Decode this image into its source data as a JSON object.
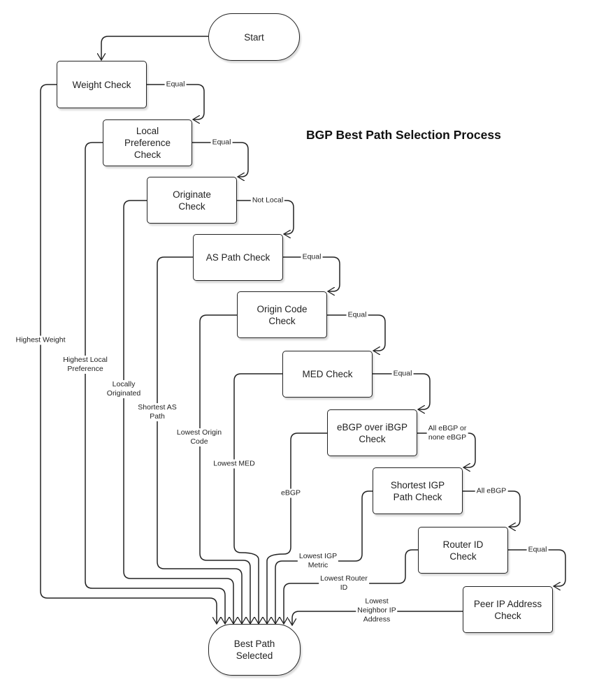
{
  "title": "BGP Best Path Selection Process",
  "nodes": {
    "start": "Start",
    "weight": "Weight Check",
    "local_pref": "Local\nPreference\nCheck",
    "originate": "Originate\nCheck",
    "as_path": "AS Path Check",
    "origin_code": "Origin Code\nCheck",
    "med": "MED Check",
    "ebgp": "eBGP over iBGP\nCheck",
    "igp": "Shortest IGP\nPath Check",
    "router_id": "Router ID\nCheck",
    "peer_ip": "Peer IP Address\nCheck",
    "end": "Best Path\nSelected"
  },
  "next_labels": {
    "weight": "Equal",
    "local_pref": "Equal",
    "originate": "Not Local",
    "as_path": "Equal",
    "origin_code": "Equal",
    "med": "Equal",
    "ebgp": "All eBGP or\nnone eBGP",
    "igp": "All eBGP",
    "router_id": "Equal"
  },
  "win_labels": {
    "weight": "Highest Weight",
    "local_pref": "Highest Local\nPreference",
    "originate": "Locally\nOriginated",
    "as_path": "Shortest AS\nPath",
    "origin_code": "Lowest Origin\nCode",
    "med": "Lowest MED",
    "ebgp": "eBGP",
    "igp": "Lowest IGP\nMetric",
    "router_id": "Lowest Router\nID",
    "peer_ip": "Lowest\nNeighbor IP\nAddress"
  },
  "colors": {
    "stroke": "#222222",
    "background": "#ffffff"
  }
}
